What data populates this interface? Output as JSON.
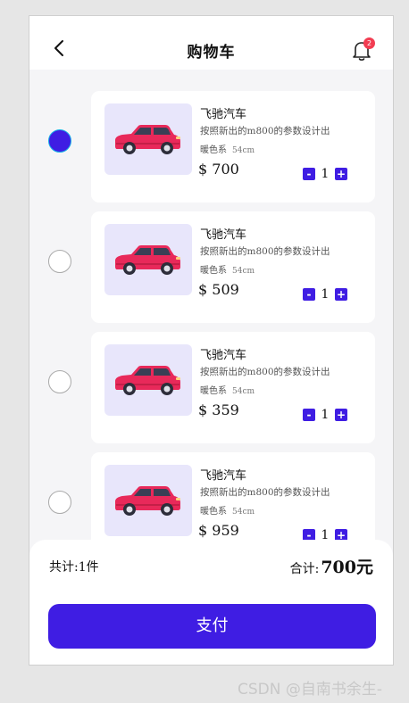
{
  "header": {
    "title": "购物车",
    "badge_count": "2"
  },
  "items": [
    {
      "name": "飞驰汽车",
      "desc": "按照新出的m800的参数设计出",
      "color": "暖色系",
      "size": "54cm",
      "price": "$ 700",
      "qty": "1",
      "checked": true
    },
    {
      "name": "飞驰汽车",
      "desc": "按照新出的m800的参数设计出",
      "color": "暖色系",
      "size": "54cm",
      "price": "$ 509",
      "qty": "1",
      "checked": false
    },
    {
      "name": "飞驰汽车",
      "desc": "按照新出的m800的参数设计出",
      "color": "暖色系",
      "size": "54cm",
      "price": "$ 359",
      "qty": "1",
      "checked": false
    },
    {
      "name": "飞驰汽车",
      "desc": "按照新出的m800的参数设计出",
      "color": "暖色系",
      "size": "54cm",
      "price": "$ 959",
      "qty": "1",
      "checked": false
    }
  ],
  "stepper": {
    "minus": "-",
    "plus": "+"
  },
  "footer": {
    "count_label": "共计:1件",
    "total_label": "合计:",
    "total_amount": "700元",
    "pay_label": "支付"
  },
  "watermark": "CSDN @自南书余生-",
  "colors": {
    "accent": "#3f1de3",
    "badge": "#f23d52",
    "car_body": "#e8295a",
    "thumb_bg": "#e8e6fb"
  }
}
